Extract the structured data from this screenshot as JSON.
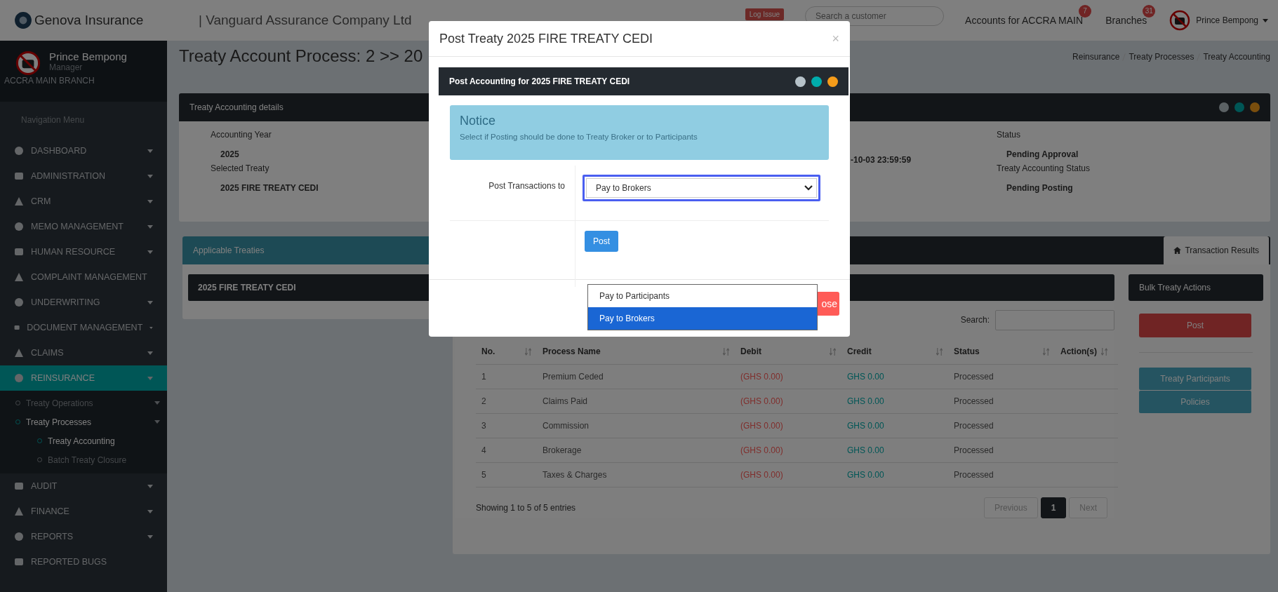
{
  "topbar": {
    "brand": "Genova Insurance",
    "company": "| Vanguard Assurance Company Ltd",
    "log_issue": "Log Issue",
    "search": {
      "placeholder": "Search a customer"
    },
    "links": [
      {
        "label": "Accounts for ACCRA MAIN",
        "badge": "7"
      },
      {
        "label": "Branches",
        "badge": "31"
      }
    ],
    "user": "Prince Bempong"
  },
  "sidebar": {
    "user": {
      "name": "Prince Bempong",
      "role": "Manager",
      "branch": "ACCRA MAIN BRANCH"
    },
    "heading": "Navigation Menu",
    "items": [
      {
        "label": "DASHBOARD",
        "caret": true,
        "selected": false
      },
      {
        "label": "ADMINISTRATION",
        "caret": true,
        "selected": false
      },
      {
        "label": "CRM",
        "caret": true,
        "selected": false
      },
      {
        "label": "MEMO MANAGEMENT",
        "caret": true,
        "selected": false
      },
      {
        "label": "HUMAN RESOURCE",
        "caret": true,
        "selected": false
      },
      {
        "label": "COMPLAINT MANAGEMENT",
        "caret": false,
        "selected": false
      },
      {
        "label": "UNDERWRITING",
        "caret": true,
        "selected": false
      },
      {
        "label": "DOCUMENT MANAGEMENT",
        "caret": true,
        "selected": false
      },
      {
        "label": "CLAIMS",
        "caret": true,
        "selected": false
      },
      {
        "label": "REINSURANCE",
        "caret": true,
        "selected": true,
        "children": [
          {
            "label": "Treaty Operations",
            "caret": true,
            "selected": false
          },
          {
            "label": "Treaty Processes",
            "caret": true,
            "selected": true,
            "children": [
              {
                "label": "Treaty Accounting",
                "selected": true
              },
              {
                "label": "Batch Treaty Closure",
                "selected": false
              }
            ]
          }
        ]
      },
      {
        "label": "AUDIT",
        "caret": true,
        "selected": false
      },
      {
        "label": "FINANCE",
        "caret": true,
        "selected": false
      },
      {
        "label": "REPORTS",
        "caret": true,
        "selected": false
      },
      {
        "label": "REPORTED BUGS",
        "caret": false,
        "selected": false
      }
    ]
  },
  "page": {
    "title": "Treaty Account Process: 2 >> 20",
    "breadcrumb": [
      "Reinsurance",
      "Treaty Processes",
      "Treaty Accounting"
    ]
  },
  "details": {
    "title": "Treaty Accounting details",
    "left": [
      {
        "label": "Accounting Year",
        "value": "2025"
      },
      {
        "label": "Selected Treaty",
        "value": "2025 FIRE TREATY CEDI"
      }
    ],
    "middle_value": "-10-03  23:59:59",
    "right": [
      {
        "label": "Status",
        "value": "Pending Approval"
      },
      {
        "label": "Treaty Accounting Status",
        "value": "Pending Posting"
      }
    ]
  },
  "applicable": {
    "title": "Applicable Treaties",
    "treaty": "2025 FIRE TREATY CEDI"
  },
  "results": {
    "tab": {
      "label": "Transaction Results",
      "selected": true
    },
    "search_label": "Search:",
    "columns": [
      "No.",
      "Process Name",
      "Debit",
      "Credit",
      "Status",
      "Action(s)"
    ],
    "rows": [
      {
        "no": "1",
        "name": "Premium Ceded",
        "debit": "(GHS 0.00)",
        "credit": "GHS 0.00",
        "status": "Processed"
      },
      {
        "no": "2",
        "name": "Claims Paid",
        "debit": "(GHS 0.00)",
        "credit": "GHS 0.00",
        "status": "Processed"
      },
      {
        "no": "3",
        "name": "Commission",
        "debit": "(GHS 0.00)",
        "credit": "GHS 0.00",
        "status": "Processed"
      },
      {
        "no": "4",
        "name": "Brokerage",
        "debit": "(GHS 0.00)",
        "credit": "GHS 0.00",
        "status": "Processed"
      },
      {
        "no": "5",
        "name": "Taxes & Charges",
        "debit": "(GHS 0.00)",
        "credit": "GHS 0.00",
        "status": "Processed"
      }
    ],
    "info": "Showing 1 to 5 of 5 entries",
    "pages": [
      {
        "label": "Previous",
        "selected": false,
        "disabled": true
      },
      {
        "label": "1",
        "selected": true,
        "disabled": false
      },
      {
        "label": "Next",
        "selected": false,
        "disabled": true
      }
    ],
    "bulk": {
      "title": "Bulk Treaty Actions",
      "post": "Post",
      "buttons": [
        "Treaty Participants",
        "Policies"
      ]
    }
  },
  "modal": {
    "title": "Post Treaty 2025 FIRE TREATY CEDI",
    "close": "×",
    "panel_title": "Post Accounting for 2025 FIRE TREATY CEDI",
    "notice": {
      "title": "Notice",
      "text": "Select if Posting should be done to Treaty Broker or to Participants"
    },
    "field": {
      "label": "Post Transactions to",
      "value": "Pay to Brokers",
      "options": [
        {
          "label": "Pay to Participants",
          "selected": false
        },
        {
          "label": "Pay to Brokers",
          "selected": true
        }
      ]
    },
    "post": "Post",
    "footer_button": "ose"
  }
}
